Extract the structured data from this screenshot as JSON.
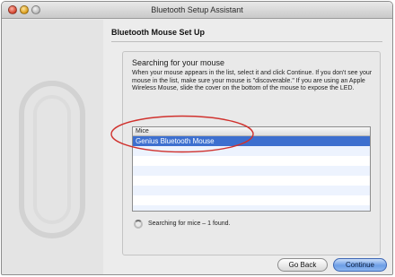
{
  "window": {
    "title": "Bluetooth Setup Assistant"
  },
  "header": {
    "title": "Bluetooth Mouse Set Up"
  },
  "panel": {
    "heading": "Searching for your mouse",
    "instructions": "When your mouse appears in the list, select it and click Continue. If you don't see your mouse in the list, make sure your mouse is \"discoverable.\" If you are using an Apple Wireless Mouse, slide the cover on the bottom of the mouse to expose the LED."
  },
  "list": {
    "column_header": "Mice",
    "items": [
      "Genius Bluetooth Mouse"
    ]
  },
  "status": {
    "text": "Searching for mice – 1 found."
  },
  "buttons": {
    "back": "Go Back",
    "continue": "Continue"
  },
  "colors": {
    "selection": "#3d6fcf",
    "annotation": "#d0312d"
  },
  "icons": {
    "sidebar_art": "mouse-outline-icon",
    "status": "spinner-icon"
  }
}
